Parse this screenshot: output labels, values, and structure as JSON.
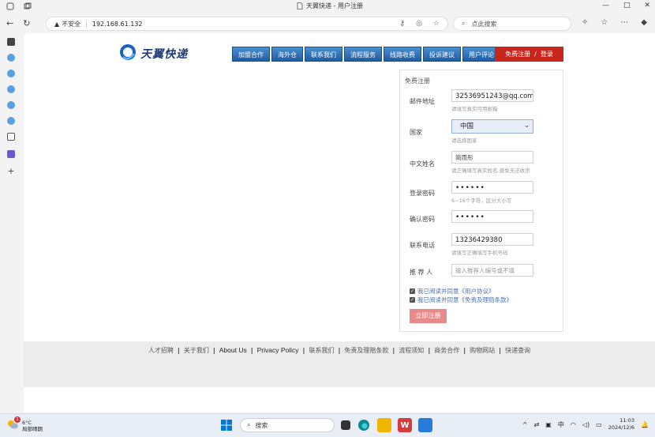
{
  "browser": {
    "tab_title": "天翼快递 - 用户注册",
    "security_label": "不安全",
    "url": "192.168.61.132",
    "search_placeholder": "点此搜索"
  },
  "site": {
    "logo_text": "天翼快递",
    "nav": [
      {
        "label": "加盟合作"
      },
      {
        "label": "海外仓"
      },
      {
        "label": "联系我们"
      },
      {
        "label": "流程服务"
      },
      {
        "label": "线路收费"
      },
      {
        "label": "投诉建议"
      },
      {
        "label": "用户评论"
      }
    ],
    "register_label": "免费注册",
    "login_label": "登录",
    "register_sep": "/"
  },
  "form": {
    "title": "免费注册",
    "email": {
      "label": "邮件地址",
      "value": "32536951243@qq.com",
      "hint": "请填写真实可用邮箱"
    },
    "country": {
      "label": "国家",
      "value": "中国",
      "hint": "请选择国家"
    },
    "name": {
      "label": "中文姓名",
      "value": "简雨彤",
      "hint": "请正确填写真实姓名,避免无法收货"
    },
    "password": {
      "label": "登录密码",
      "value": "••••••",
      "hint": "6~16个字符，区分大小写"
    },
    "confirm": {
      "label": "确认密码",
      "value": "••••••"
    },
    "phone": {
      "label": "联系电话",
      "value": "13236429380",
      "hint": "请填写正确填写手机号码"
    },
    "referrer": {
      "label": "推 荐 人",
      "placeholder": "输入推荐人编号或不填"
    },
    "agree_user": "我已阅读并同意《用户协议》",
    "agree_terms": "我已阅读并同意《免责及理赔条款》",
    "submit_label": "立即注册"
  },
  "footer": {
    "links": [
      "人才招聘",
      "关于我们",
      "About Us",
      "Privacy Policy",
      "联系我们",
      "免责及理赔条款",
      "流程须知",
      "商务合作",
      "购物网站",
      "快递查询"
    ],
    "separator": "|"
  },
  "taskbar": {
    "weather_temp": "6°C",
    "weather_desc": "局部晴朗",
    "weather_badge": "1",
    "search_label": "搜索",
    "ime": "中",
    "time": "11:03",
    "date": "2024/12/6"
  },
  "colors": {
    "nav_blue": "#2a6db5",
    "register_red": "#c8261c",
    "submit_pink": "#e88a8a",
    "link_blue": "#4a6fb0"
  }
}
